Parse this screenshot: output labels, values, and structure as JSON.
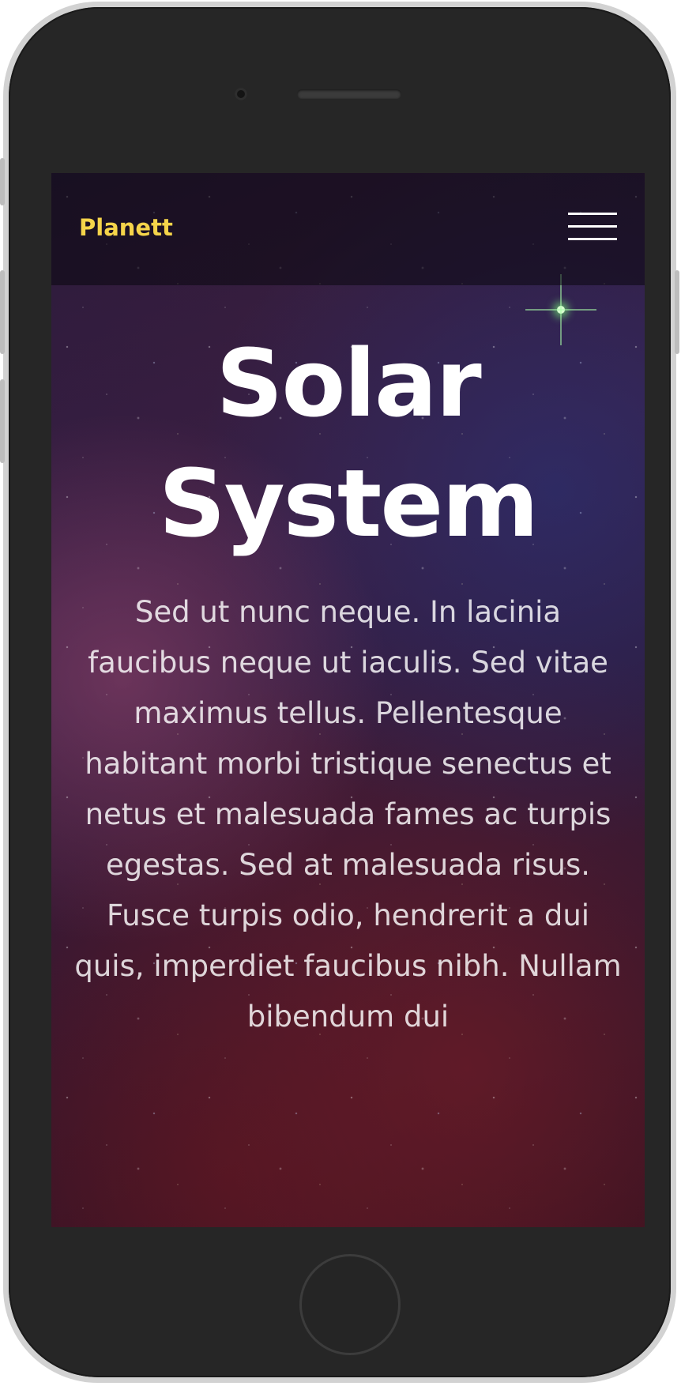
{
  "header": {
    "brand": "Planett",
    "menu_icon": "hamburger-menu-icon"
  },
  "hero": {
    "title": "Solar System",
    "text": "Sed ut nunc neque. In lacinia faucibus neque ut iaculis. Sed vitae maximus tellus. Pellentesque habitant morbi tristique senectus et netus et malesuada fames ac turpis egestas. Sed at malesuada risus. Fusce turpis odio, hendrerit a dui quis, imperdiet faucibus nibh. Nullam bibendum dui"
  },
  "colors": {
    "brand": "#f5d44a",
    "title": "#ffffff",
    "phone_body": "#262626"
  }
}
